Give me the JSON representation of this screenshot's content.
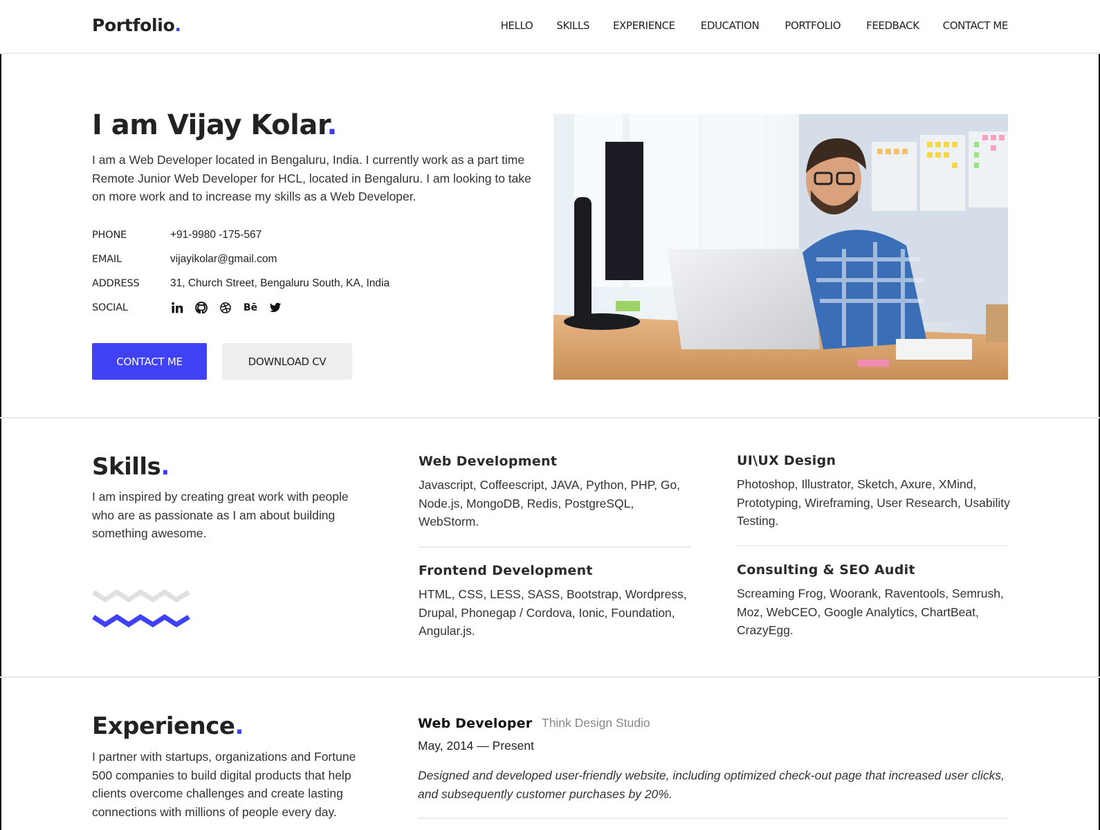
{
  "header": {
    "logo_text": "Portfolio",
    "logo_dot": ".",
    "nav": [
      "HELLO",
      "SKILLS",
      "EXPERIENCE",
      "EDUCATION",
      "PORTFOLIO",
      "FEEDBACK",
      "CONTACT ME"
    ]
  },
  "colors": {
    "accent": "#4040f5",
    "text": "#222222",
    "muted": "#888888",
    "secondary_button": "#eeeeee",
    "zigzag_light": "#e0e0e0"
  },
  "hero": {
    "title": "I am Vijay Kolar",
    "title_dot": ".",
    "description": "I am a Web Developer located in Bengaluru, India. I currently work as a part time Remote Junior Web Developer for HCL, located in Bengaluru. I am looking to take on more work and to increase my skills as a Web Developer.",
    "info": [
      {
        "label": "PHONE",
        "value": "+91-9980 -175-567"
      },
      {
        "label": "EMAIL",
        "value": "vijayikolar@gmail.com"
      },
      {
        "label": "ADDRESS",
        "value": "31, Church Street, Bengaluru South, KA, India"
      }
    ],
    "social_label": "SOCIAL",
    "socials": [
      "linkedin-icon",
      "github-icon",
      "dribbble-icon",
      "behance-icon",
      "twitter-icon"
    ],
    "behance_text": "Bē",
    "contact_button": "CONTACT ME",
    "download_button": "DOWNLOAD CV",
    "photo_alt": "Smiling developer at desk with laptop and monitor"
  },
  "skills": {
    "title": "Skills",
    "title_dot": ".",
    "description": "I am inspired by creating great work with people who are as passionate as I am about building something awesome.",
    "items": [
      {
        "title": "Web Development",
        "text": "Javascript, Coffeescript, JAVA, Python, PHP, Go, Node.js, MongoDB, Redis, PostgreSQL, WebStorm."
      },
      {
        "title": "UI\\UX Design",
        "text": "Photoshop, Illustrator, Sketch, Axure, XMind, Prototyping, Wireframing, User Research, Usability Testing."
      },
      {
        "title": "Frontend Development",
        "text": "HTML, CSS, LESS, SASS, Bootstrap, Wordpress, Drupal, Phonegap / Cordova, Ionic, Foundation, Angular.js."
      },
      {
        "title": "Consulting & SEO Audit",
        "text": "Screaming Frog, Woorank, Raventools, Semrush, Moz, WebCEO, Google Analytics, ChartBeat, CrazyEgg."
      }
    ]
  },
  "experience": {
    "title": "Experience",
    "title_dot": ".",
    "description": "I partner with startups, organizations and Fortune 500 companies to build digital products that help clients overcome challenges and create lasting connections with millions of people every day.",
    "jobs": [
      {
        "title": "Web Developer",
        "company": "Think Design Studio",
        "dates": "May, 2014 — Present",
        "description": "Designed and developed user-friendly website, including optimized check-out page that increased user clicks, and subsequently customer purchases by 20%."
      }
    ]
  }
}
